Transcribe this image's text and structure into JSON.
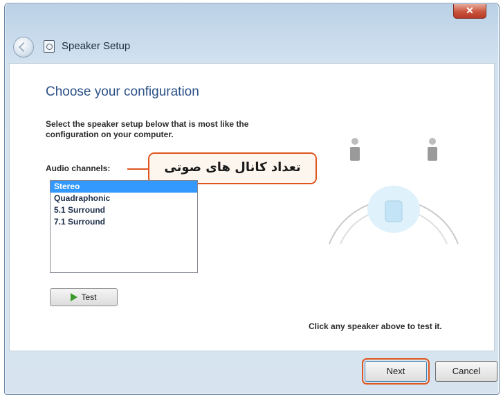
{
  "window": {
    "title": "Speaker Setup",
    "close_label": "✕"
  },
  "main": {
    "heading": "Choose your configuration",
    "instructions": "Select the speaker setup below that is most like the configuration on your computer.",
    "audio_channels_label": "Audio channels:",
    "annotation": "تعداد کانال های صوتی",
    "channels": [
      {
        "label": "Stereo",
        "selected": true
      },
      {
        "label": "Quadraphonic",
        "selected": false
      },
      {
        "label": "5.1 Surround",
        "selected": false
      },
      {
        "label": "7.1 Surround",
        "selected": false
      }
    ],
    "test_label": "Test",
    "hint": "Click any speaker above to test it."
  },
  "footer": {
    "next_label": "Next",
    "cancel_label": "Cancel"
  },
  "colors": {
    "heading": "#2a4f86",
    "selection": "#3399ff",
    "annotation_border": "#e0551f"
  },
  "icons": {
    "back": "back-arrow-icon",
    "app": "speaker-setup-icon",
    "test": "play-icon"
  }
}
